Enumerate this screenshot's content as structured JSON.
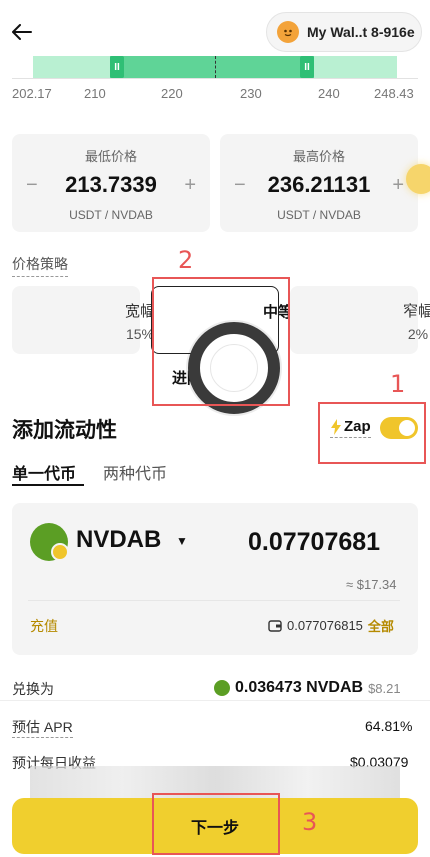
{
  "header": {
    "back_icon": "arrow-left-icon",
    "wallet_name": "My Wal..t 8-916e",
    "wallet_avatar_icon": "emoji-avatar-icon"
  },
  "range_chart": {
    "ticks": [
      "202.17",
      "210",
      "220",
      "230",
      "240",
      "248.43"
    ],
    "handle_glyph": "II",
    "colors": {
      "track": "#b9f0d2",
      "selected": "#5fd497",
      "handle": "#2fbf75"
    }
  },
  "min_price": {
    "label": "最低价格",
    "value": "213.7339",
    "unit": "USDT / NVDAB",
    "minus": "−",
    "plus": "+"
  },
  "max_price": {
    "label": "最高价格",
    "value": "236.21131",
    "unit": "USDT / NVDAB",
    "minus": "−",
    "plus": "+"
  },
  "strategy": {
    "label": "价格策略",
    "options": [
      {
        "name": "宽幅",
        "pct": "15%"
      },
      {
        "name": "中等",
        "pct": ""
      },
      {
        "name": "窄幅",
        "pct": "2%"
      }
    ],
    "selected_index": 1,
    "advanced_label": "进阶"
  },
  "annotations": [
    "1",
    "2",
    "3"
  ],
  "add_liquidity": {
    "title": "添加流动性",
    "zap_label": "Zap",
    "zap_enabled": true,
    "tabs": [
      "单一代币",
      "两种代币"
    ],
    "active_tab": 0
  },
  "token_card": {
    "token": "NVDAB",
    "amount": "0.07707681",
    "usd_value": "≈ $17.34",
    "deposit_label": "充值",
    "balance": "0.077076815",
    "all_label": "全部",
    "wallet_icon": "wallet-icon"
  },
  "summary": {
    "convert_label": "兑换为",
    "convert_amount": "0.036473 NVDAB",
    "convert_usd": "$8.21",
    "apr_label": "预估 APR",
    "apr_value": "64.81%",
    "daily_label": "预计每日收益",
    "daily_value": "$0.03079"
  },
  "footer": {
    "next_label": "下一步"
  },
  "colors": {
    "accent_yellow": "#f0cf2e",
    "annotation_red": "#e85656",
    "link_gold": "#b58a00"
  }
}
